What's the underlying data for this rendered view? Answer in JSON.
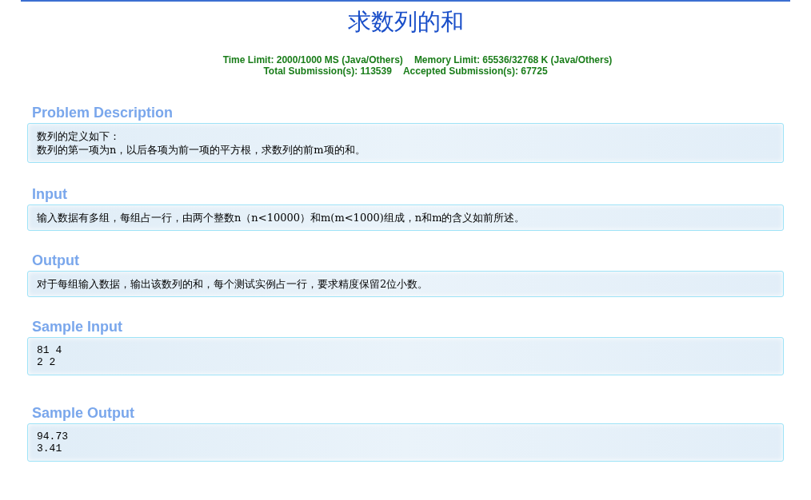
{
  "title": "求数列的和",
  "limits": [
    "Time Limit: 2000/1000 MS (Java/Others)",
    "Memory Limit: 65536/32768 K (Java/Others)"
  ],
  "submissions": [
    "Total Submission(s): 113539",
    "Accepted Submission(s): 67725"
  ],
  "sections": [
    {
      "heading": "Problem Description",
      "kind": "text",
      "lines": [
        "数列的定义如下：",
        "数列的第一项为n，以后各项为前一项的平方根，求数列的前m项的和。"
      ]
    },
    {
      "heading": "Input",
      "kind": "text",
      "lines": [
        "输入数据有多组，每组占一行，由两个整数n（n<10000）和m(m<1000)组成，n和m的含义如前所述。"
      ]
    },
    {
      "heading": "Output",
      "kind": "text",
      "lines": [
        "对于每组输入数据，输出该数列的和，每个测试实例占一行，要求精度保留2位小数。"
      ]
    },
    {
      "heading": "Sample Input",
      "kind": "code",
      "lines": [
        "81 4",
        "2 2"
      ]
    },
    {
      "heading": "Sample Output",
      "kind": "code",
      "lines": [
        "94.73",
        "3.41"
      ]
    }
  ]
}
